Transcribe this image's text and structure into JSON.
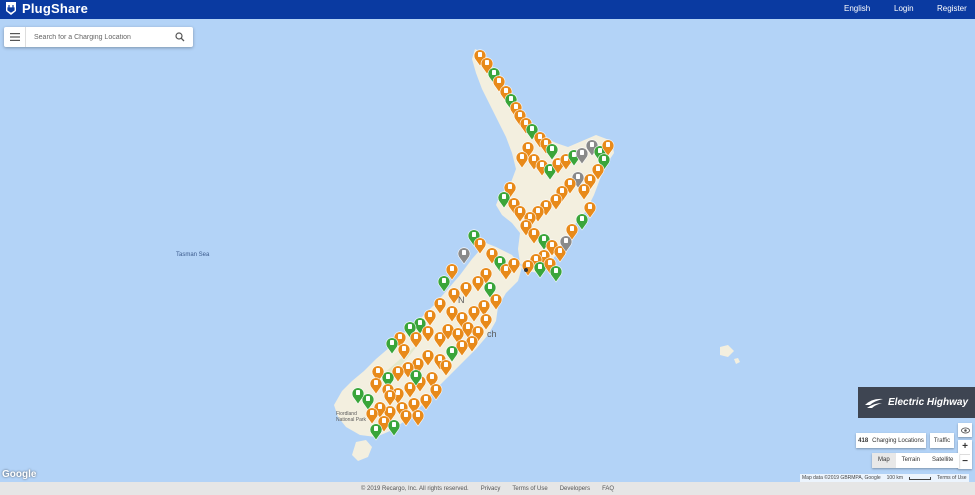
{
  "header": {
    "brand": "PlugShare",
    "nav": [
      {
        "label": "English"
      },
      {
        "label": "Login"
      },
      {
        "label": "Register"
      }
    ],
    "bar_color": "#0a3aa1"
  },
  "search": {
    "placeholder": "Search for a Charging Location",
    "menu_icon": "hamburger-menu-icon",
    "search_icon": "magnifier-icon"
  },
  "map": {
    "sea_label": "Tasman Sea",
    "place_labels": [
      "N",
      "ch",
      "Fiordland National Park"
    ],
    "marker_colors": {
      "orange": "#e88a1a",
      "green": "#3aa53a",
      "gray": "#8a8a8a"
    },
    "water_color": "#b3d3f7",
    "land_color": "#f3efdf"
  },
  "badge": {
    "text": "Electric Highway",
    "background": "#3e4552"
  },
  "controls": {
    "count_value": "418",
    "count_label": "Charging Locations",
    "traffic": "Traffic",
    "zoom_in": "+",
    "zoom_out": "−",
    "map_types": [
      "Map",
      "Terrain",
      "Satellite"
    ],
    "active_map_type": "Map"
  },
  "attribution": {
    "google": "Google",
    "map_data": "Map data ©2019 GBRMPA, Google",
    "scale": "100 km",
    "terms": "Terms of Use"
  },
  "footer": {
    "copyright": "© 2019 Recargo, Inc. All rights reserved.",
    "links": [
      "Privacy",
      "Terms of Use",
      "Developers",
      "FAQ"
    ]
  }
}
